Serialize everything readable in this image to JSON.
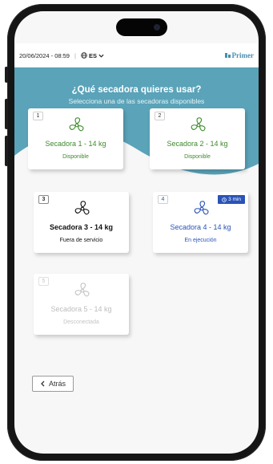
{
  "topbar": {
    "datetime": "20/06/2024 - 08:59",
    "separator": "|",
    "language": "ES",
    "brand": "Primer"
  },
  "header": {
    "title": "¿Qué secadora quieres usar?",
    "subtitle": "Selecciona una de las secadoras disponibles"
  },
  "dryers": [
    {
      "number": "1",
      "name": "Secadora 1 - 14 kg",
      "status": "Disponible",
      "state": "available",
      "color": "#3e8a2c",
      "icon": "fan-icon"
    },
    {
      "number": "2",
      "name": "Secadora 2 - 14 kg",
      "status": "Disponible",
      "state": "available",
      "color": "#3e8a2c",
      "icon": "fan-icon"
    },
    {
      "number": "3",
      "name": "Secadora 3 - 14 kg",
      "status": "Fuera de servicio",
      "state": "out-of-service",
      "color": "#111111",
      "icon": "fan-icon"
    },
    {
      "number": "4",
      "name": "Secadora 4 - 14 kg",
      "status": "En ejecución",
      "state": "running",
      "color": "#2a53b8",
      "icon": "fan-icon",
      "badge": "3 min"
    },
    {
      "number": "5",
      "name": "Secadora 5 - 14 kg",
      "status": "Desconectada",
      "state": "disconnected",
      "color": "#c4c4c4",
      "icon": "fan-icon"
    }
  ],
  "back_button": {
    "label": "Atrás",
    "icon": "chevron-left-icon"
  },
  "colors": {
    "hero": "#5aa3b9",
    "available": "#3e8a2c",
    "running": "#2a53b8",
    "disconnected": "#c4c4c4",
    "brand": "#4a8fb0"
  }
}
